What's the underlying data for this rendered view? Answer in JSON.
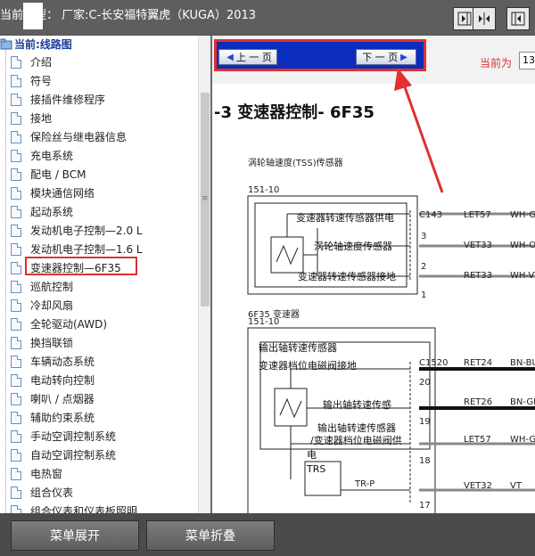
{
  "topbar": {
    "title": "当前车型：  厂家:C-长安福特翼虎（KUGA）2013"
  },
  "tree": {
    "root": "当前:线路图",
    "items": [
      "介绍",
      "符号",
      "接插件维修程序",
      "接地",
      "保险丝与继电器信息",
      "充电系统",
      "配电 / BCM",
      "模块通信网络",
      "起动系统",
      "发动机电子控制—2.0 L",
      "发动机电子控制—1.6 L",
      "变速器控制—6F35",
      "巡航控制",
      "冷却风扇",
      "全轮驱动(AWD)",
      "换挡联锁",
      "车辆动态系统",
      "电动转向控制",
      "喇叭 / 点烟器",
      "辅助约束系统",
      "手动空调控制系统",
      "自动空调控制系统",
      "电热窗",
      "组合仪表",
      "组合仪表和仪表板照明"
    ],
    "selected_index": 11
  },
  "nav": {
    "prev_label": "上 一 页",
    "next_label": "下 一 页",
    "current_label": "当前为",
    "current_value": "13"
  },
  "document": {
    "title": "-3     变速器控制- 6F35",
    "section1_label": "涡轮轴速度(TSS)传感器",
    "section1_code": "151-10",
    "s1_row1": "变速器转速传感器供电",
    "s1_row2": "涡轮轴速度传感器",
    "s1_row3": "变速器转速传感器接地",
    "s1_connector": "C143",
    "s1_pins": [
      "3",
      "2",
      "1"
    ],
    "s1_circuits": [
      "LET57",
      "VET33",
      "RET33"
    ],
    "s1_wires": [
      "WH-GN",
      "WH-OG",
      "WH-VT"
    ],
    "section2_label": "6F35 变速器",
    "section2_code": "151-10",
    "s2_header": "输出轴转速传感器",
    "s2_row1": "变速器档位电磁阀接地",
    "s2_row2": "输出轴转速传感",
    "s2_row3a": "输出轴转速传感器",
    "s2_row3b": "/变速器档位电磁阀供",
    "s2_row3c": "电",
    "s2_trs": "TRS",
    "s2_trp": "TR-P",
    "s2_connector": "C1520",
    "s2_pins": [
      "20",
      "19",
      "18",
      "17"
    ],
    "s2_circuits": [
      "RET24",
      "RET26",
      "LET57",
      "VET32"
    ],
    "s2_wires": [
      "BN-BU",
      "BN-GN",
      "WH-GN",
      "VT"
    ]
  },
  "bottom": {
    "expand_label": "菜单展开",
    "collapse_label": "菜单折叠"
  },
  "colors": {
    "highlight": "#e03030",
    "nav_frame": "#0a2dbd"
  }
}
